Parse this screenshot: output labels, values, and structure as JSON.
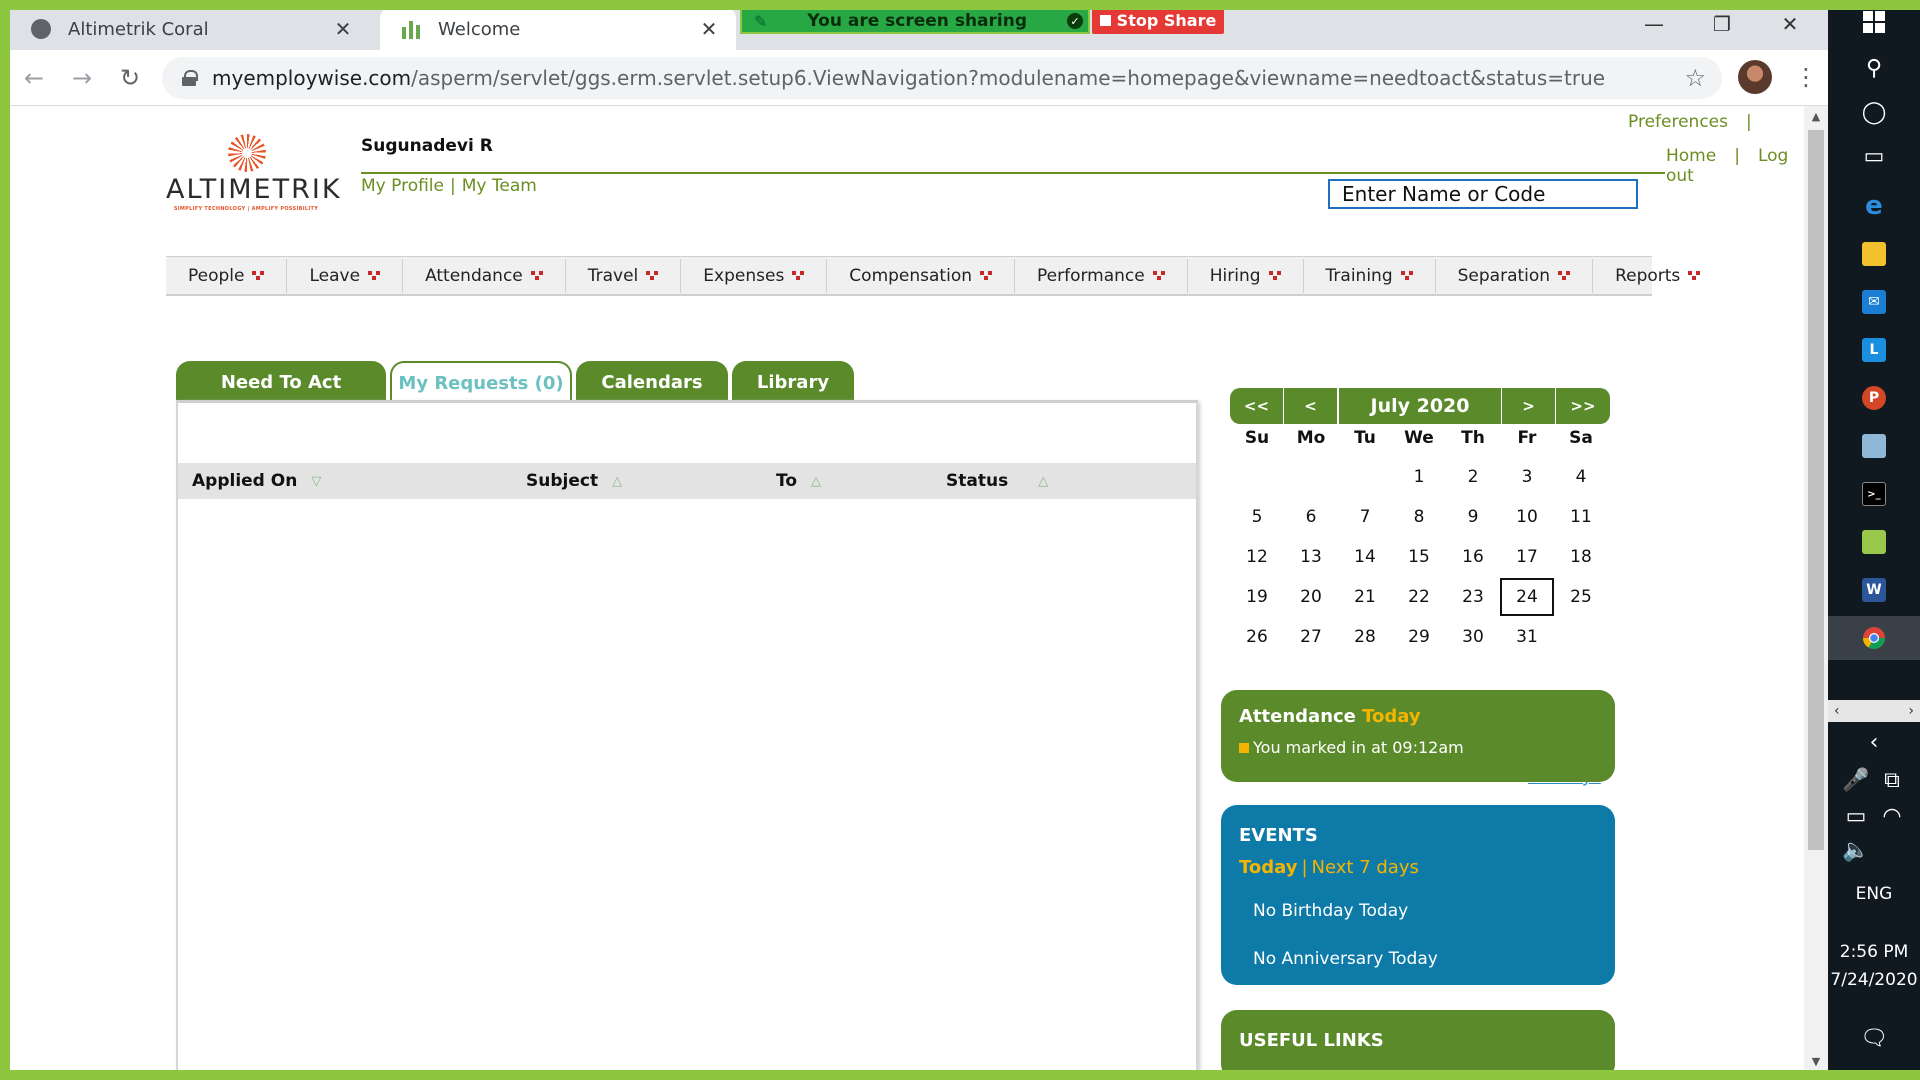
{
  "browser": {
    "tabs": [
      {
        "title": "Altimetrik Coral",
        "close": "✕"
      },
      {
        "title": "Welcome",
        "close": "✕"
      }
    ],
    "screen_share": {
      "banner": "You are screen sharing",
      "stop_label": "Stop Share"
    },
    "address": {
      "host": "myemploywise.com",
      "path": "/asperm/servlet/ggs.erm.servlet.setup6.ViewNavigation?modulename=homepage&viewname=needtoact&status=true"
    },
    "window_controls": {
      "minimize": "—",
      "restore": "❐",
      "close": "✕"
    }
  },
  "header": {
    "logo": {
      "brand": "ALTIMETRIK",
      "tagline": "SIMPLIFY TECHNOLOGY | AMPLIFY POSSIBILITY"
    },
    "user_name": "Sugunadevi R",
    "my_profile": "My Profile",
    "separator": "|",
    "my_team": "My Team",
    "preferences": "Preferences",
    "home": "Home",
    "logout": "Log out",
    "search_placeholder": "Enter Name or Code"
  },
  "menu": [
    "People",
    "Leave",
    "Attendance",
    "Travel",
    "Expenses",
    "Compensation",
    "Performance",
    "Hiring",
    "Training",
    "Separation",
    "Reports"
  ],
  "tabs": {
    "need_to_act": "Need To Act",
    "my_requests": "My Requests (0)",
    "calendars": "Calendars",
    "library": "Library"
  },
  "requests_table": {
    "columns": [
      "Applied On",
      "Subject",
      "To",
      "Status"
    ],
    "rows": []
  },
  "calendar": {
    "month": "July 2020",
    "prev_year": "<<",
    "prev_month": "<",
    "next_month": ">",
    "next_year": ">>",
    "weekdays": [
      "Su",
      "Mo",
      "Tu",
      "We",
      "Th",
      "Fr",
      "Sa"
    ],
    "first_weekday_index": 3,
    "days_in_month": 31,
    "today": 24,
    "holidays_link": "Holidays"
  },
  "attendance": {
    "title": "Attendance",
    "title_highlight": "Today",
    "message": "You marked in at 09:12am"
  },
  "events": {
    "title": "EVENTS",
    "today_link": "Today",
    "separator": "|",
    "next_link": "Next 7 days",
    "birthday": "No Birthday Today",
    "anniversary": "No Anniversary Today"
  },
  "useful_links": {
    "title": "USEFUL LINKS"
  },
  "taskbar": {
    "language": "ENG",
    "time": "2:56 PM",
    "date": "7/24/2020"
  },
  "colors": {
    "primary_green": "#5a8a2a",
    "events_blue": "#0e7aa8",
    "highlight_yellow": "#f5b400",
    "share_border": "#8dc63f"
  }
}
